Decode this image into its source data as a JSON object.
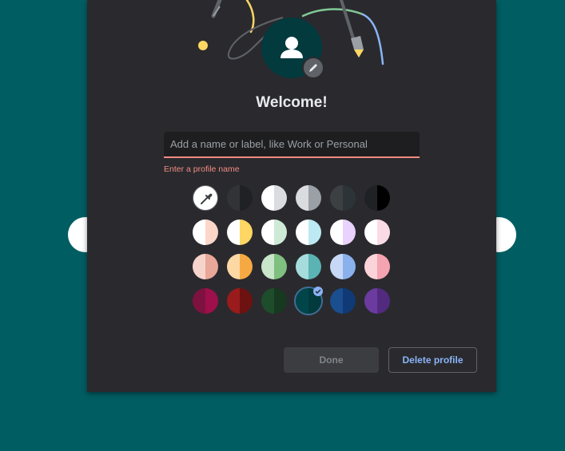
{
  "title": "Welcome!",
  "input": {
    "value": "",
    "placeholder": "Add a name or label, like Work or Personal"
  },
  "error_text": "Enter a profile name",
  "buttons": {
    "done": "Done",
    "delete": "Delete profile"
  },
  "swatch_rows": [
    [
      {
        "kind": "picker",
        "icon": "eyedropper-icon"
      },
      {
        "kind": "color",
        "left": "#323336",
        "right": "#202124"
      },
      {
        "kind": "color",
        "left": "#ffffff",
        "right": "#dadce0"
      },
      {
        "kind": "color",
        "left": "#dadce0",
        "right": "#9aa0a6"
      },
      {
        "kind": "color",
        "left": "#3c4043",
        "right": "#2d3438"
      },
      {
        "kind": "color",
        "left": "#202124",
        "right": "#000000"
      }
    ],
    [
      {
        "kind": "color",
        "left": "#ffffff",
        "right": "#fcd7c9"
      },
      {
        "kind": "color",
        "left": "#ffffff",
        "right": "#fdd663"
      },
      {
        "kind": "color",
        "left": "#ffffff",
        "right": "#ceead6"
      },
      {
        "kind": "color",
        "left": "#ffffff",
        "right": "#bde9f2"
      },
      {
        "kind": "color",
        "left": "#ffffff",
        "right": "#e9d2fd"
      },
      {
        "kind": "color",
        "left": "#ffffff",
        "right": "#fadbe5"
      }
    ],
    [
      {
        "kind": "color",
        "left": "#f6d4cc",
        "right": "#e8a799"
      },
      {
        "kind": "color",
        "left": "#fcd8a5",
        "right": "#f6a942"
      },
      {
        "kind": "color",
        "left": "#c8e6c9",
        "right": "#7fbf7f"
      },
      {
        "kind": "color",
        "left": "#a6dcdc",
        "right": "#5bb3b3"
      },
      {
        "kind": "color",
        "left": "#c6d8f6",
        "right": "#8ab1ec"
      },
      {
        "kind": "color",
        "left": "#fbd3da",
        "right": "#f4a3b0"
      }
    ],
    [
      {
        "kind": "color",
        "left": "#7d1240",
        "right": "#9e0f4b"
      },
      {
        "kind": "color",
        "left": "#9a1b1b",
        "right": "#6e1111"
      },
      {
        "kind": "color",
        "left": "#1e4d2b",
        "right": "#17391f"
      },
      {
        "kind": "color",
        "left": "#004549",
        "right": "#023a3e",
        "selected": true
      },
      {
        "kind": "color",
        "left": "#1a4e8e",
        "right": "#0f3a75"
      },
      {
        "kind": "color",
        "left": "#6b3ba0",
        "right": "#522a7f"
      }
    ]
  ],
  "colors": {
    "background": "#005d62",
    "dialog": "#2a2a2e",
    "accent": "#8ab4f8",
    "error": "#f28b82",
    "avatar_bg": "#023a3e"
  }
}
